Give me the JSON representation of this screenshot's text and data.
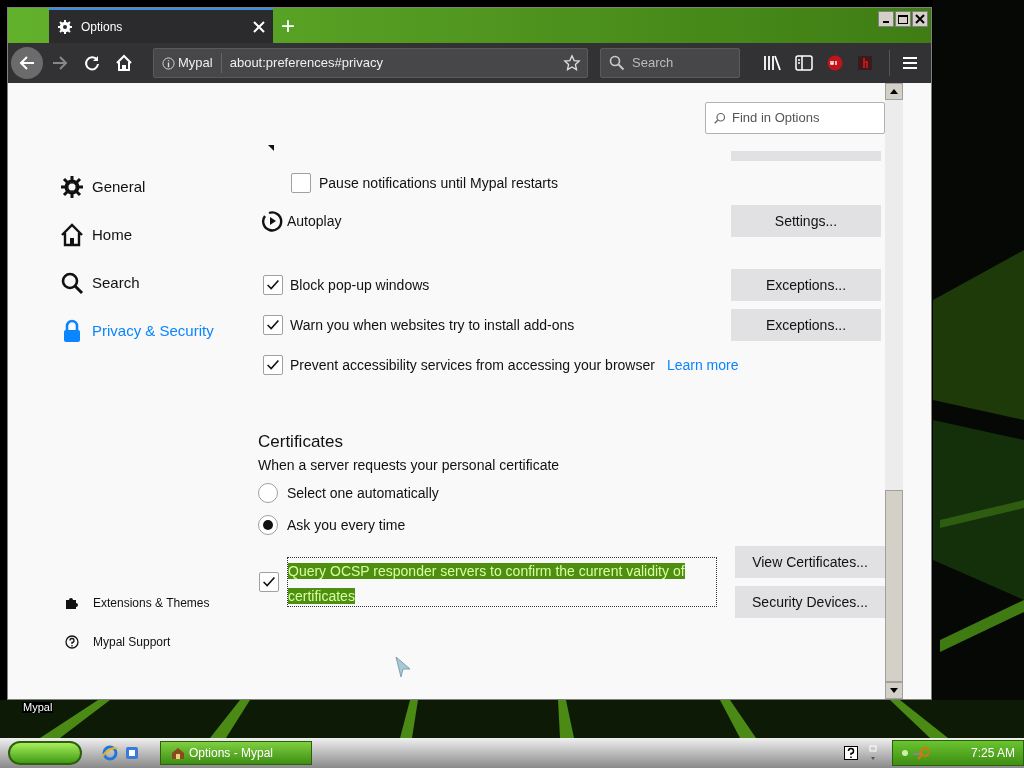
{
  "tab": {
    "title": "Options",
    "selected": true
  },
  "new_tab": "+",
  "toolbar": {
    "identity": "Mypal",
    "url": "about:preferences#privacy",
    "search_placeholder": "Search"
  },
  "find": {
    "placeholder": "Find in Options"
  },
  "sidebar": {
    "items": [
      {
        "label": "General",
        "selected": false
      },
      {
        "label": "Home",
        "selected": false
      },
      {
        "label": "Search",
        "selected": false
      },
      {
        "label": "Privacy & Security",
        "selected": true
      }
    ],
    "footer": [
      "Extensions & Themes",
      "Mypal Support"
    ]
  },
  "pause": {
    "label": "Pause notifications until Mypal restarts",
    "checked": false
  },
  "autoplay": {
    "label": "Autoplay",
    "button": "Settings..."
  },
  "checks": [
    {
      "label": "Block pop-up windows",
      "checked": true,
      "button": "Exceptions..."
    },
    {
      "label": "Warn you when websites try to install add-ons",
      "checked": true,
      "button": "Exceptions..."
    },
    {
      "label": "Prevent accessibility services from accessing your browser",
      "checked": true,
      "link": "Learn more"
    }
  ],
  "certificates": {
    "heading": "Certificates",
    "prompt": "When a server requests your personal certificate",
    "options": [
      {
        "label": "Select one automatically",
        "selected": false
      },
      {
        "label": "Ask you every time",
        "selected": true
      }
    ],
    "ocsp": {
      "label": "Query OCSP responder servers to confirm the current validity of certificates",
      "checked": true
    },
    "buttons": [
      "View Certificates...",
      "Security Devices..."
    ]
  },
  "desktop": {
    "icon_label": "Mypal"
  },
  "taskbar": {
    "task": "Options - Mypal",
    "clock": "7:25 AM"
  }
}
